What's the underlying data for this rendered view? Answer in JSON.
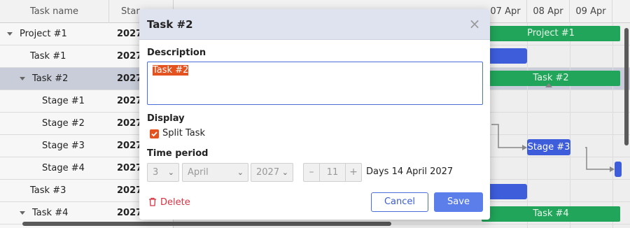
{
  "grid": {
    "columns": [
      "Task name",
      "Star"
    ],
    "rows": [
      {
        "name": "Project #1",
        "start": "2027-",
        "caret": true,
        "indent": 0,
        "selected": false
      },
      {
        "name": "Task #1",
        "start": "2027-",
        "caret": false,
        "indent": 1,
        "selected": false
      },
      {
        "name": "Task #2",
        "start": "2027-",
        "caret": true,
        "indent": 1,
        "selected": true
      },
      {
        "name": "Stage #1",
        "start": "2027-",
        "caret": false,
        "indent": 2,
        "selected": false
      },
      {
        "name": "Stage #2",
        "start": "2027-",
        "caret": false,
        "indent": 2,
        "selected": false
      },
      {
        "name": "Stage #3",
        "start": "2027-",
        "caret": false,
        "indent": 2,
        "selected": false
      },
      {
        "name": "Stage #4",
        "start": "2027-",
        "caret": false,
        "indent": 2,
        "selected": false
      },
      {
        "name": "Task #3",
        "start": "2027-",
        "caret": false,
        "indent": 1,
        "selected": false
      },
      {
        "name": "Task #4",
        "start": "2027-",
        "caret": true,
        "indent": 1,
        "selected": false
      }
    ]
  },
  "timeline": {
    "columns": [
      "07 Apr",
      "08 Apr",
      "09 Apr"
    ],
    "bars": {
      "project1": "Project #1",
      "task2": "Task #2",
      "stage3": "Stage #3",
      "task4": "Task #4"
    }
  },
  "dialog": {
    "title": "Task #2",
    "close_symbol": "×",
    "description_label": "Description",
    "description_value": "Task #2",
    "display_label": "Display",
    "split_task_label": "Split Task",
    "split_task_checked": true,
    "time_period_label": "Time period",
    "duration_value": "3",
    "month_value": "April",
    "year_value": "2027",
    "stepper_minus": "–",
    "stepper_value": "11",
    "stepper_plus": "+",
    "days_text": "Days 14 April 2027",
    "delete_label": "Delete",
    "cancel_label": "Cancel",
    "save_label": "Save"
  },
  "colors": {
    "accent": "#5b7eea",
    "checkbox": "#e4531f",
    "bar_green": "#21a55a",
    "bar_blue": "#3d5ddb",
    "delete": "#d63343"
  }
}
